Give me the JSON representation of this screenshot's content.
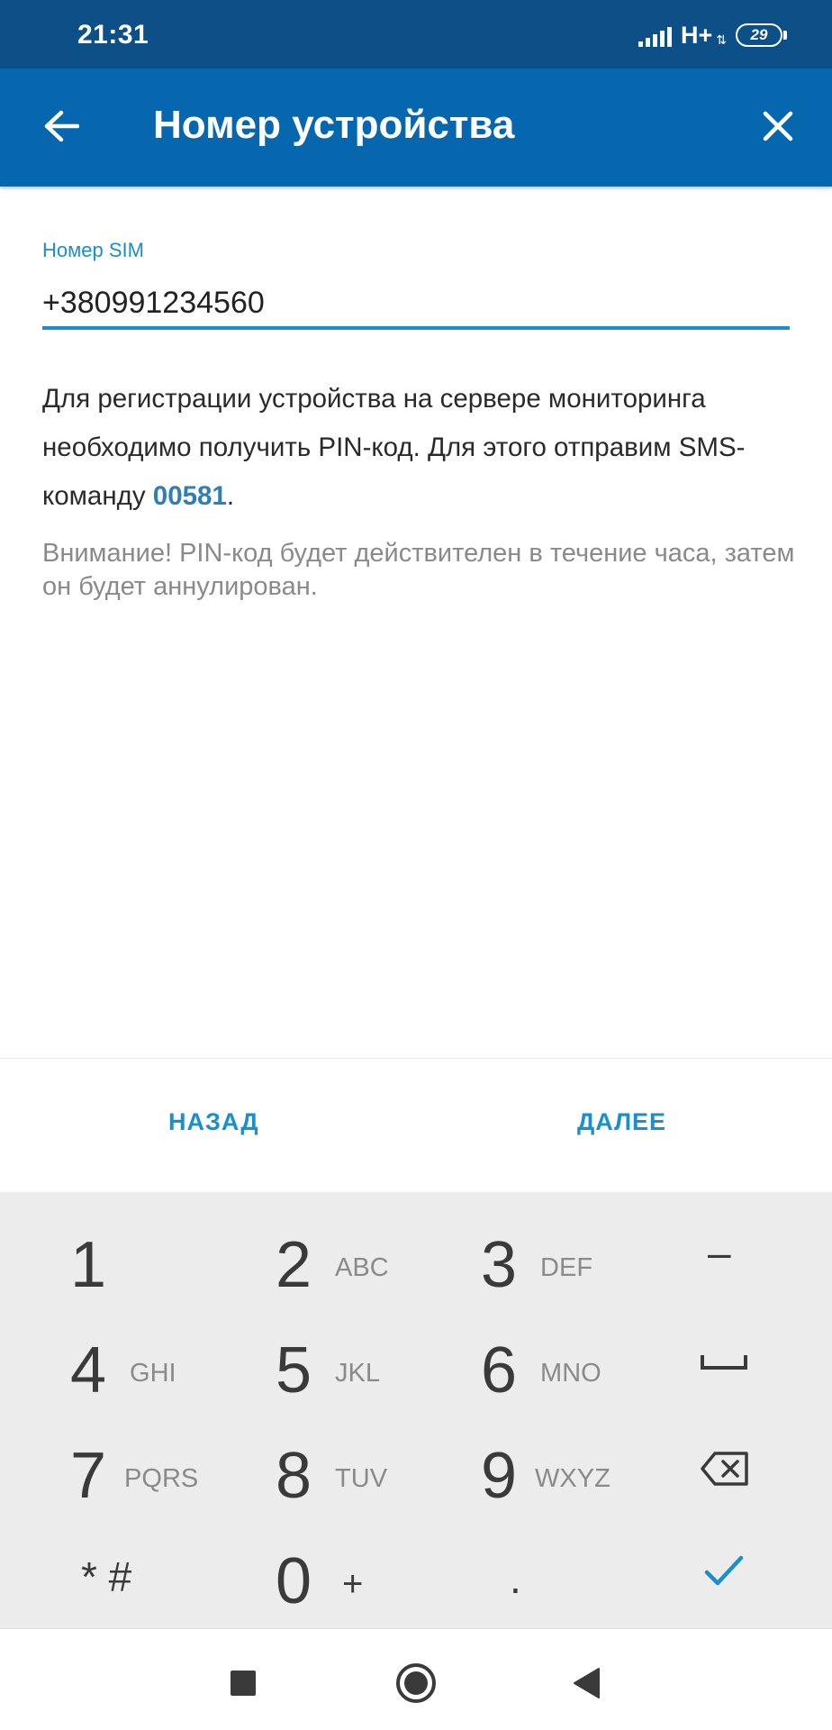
{
  "status_bar": {
    "time": "21:31",
    "network": "H+",
    "battery": "29"
  },
  "app_bar": {
    "title": "Номер устройства",
    "back_icon": "arrow-back-icon",
    "close_icon": "close-icon"
  },
  "form": {
    "sim_label": "Номер SIM",
    "sim_value": "+380991234560"
  },
  "description": {
    "text_before": "Для регистрации устройства на сервере мониторинга необходимо получить PIN-код. Для этого отправим SMS-команду ",
    "code": "00581",
    "text_after": "."
  },
  "warning": "Внимание! PIN-код будет действителен в течение часа, затем он будет аннулирован.",
  "buttons": {
    "back": "НАЗАД",
    "next": "ДАЛЕЕ"
  },
  "keypad": {
    "keys": [
      {
        "digit": "1",
        "letters": ""
      },
      {
        "digit": "2",
        "letters": "ABC"
      },
      {
        "digit": "3",
        "letters": "DEF"
      },
      {
        "digit": "4",
        "letters": "GHI"
      },
      {
        "digit": "5",
        "letters": "JKL"
      },
      {
        "digit": "6",
        "letters": "MNO"
      },
      {
        "digit": "7",
        "letters": "PQRS"
      },
      {
        "digit": "8",
        "letters": "TUV"
      },
      {
        "digit": "9",
        "letters": "WXYZ"
      },
      {
        "digit": "0",
        "letters": "+"
      }
    ],
    "symbols": {
      "minus": "–",
      "star_hash": "* #",
      "dot": "."
    },
    "icons": {
      "space": "space-icon",
      "backspace": "backspace-icon",
      "done": "checkmark-icon"
    },
    "accent_color": "#1a8ecf"
  },
  "nav_bar": {
    "icons": [
      "recents-square-icon",
      "home-circle-icon",
      "back-triangle-icon"
    ]
  },
  "colors": {
    "status_bar": "#0d5087",
    "app_bar": "#0667ae",
    "accent": "#1a8ecf",
    "code": "#2f7fb3"
  }
}
